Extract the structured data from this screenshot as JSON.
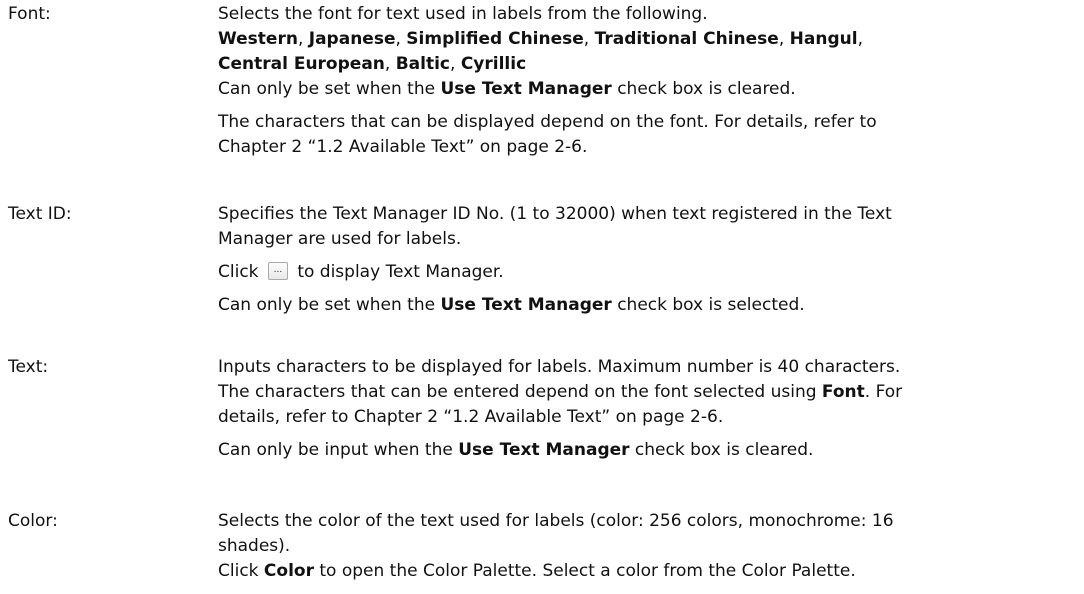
{
  "font": {
    "term": "Font:",
    "intro": "Selects the font for text used in labels from the following.",
    "options": [
      "Western",
      "Japanese",
      "Simplified Chinese",
      "Traditional Chinese",
      "Hangul",
      "Central European",
      "Baltic",
      "Cyrillic"
    ],
    "sep": ", ",
    "note_pre": "Can only be set when the ",
    "note_bold": "Use Text Manager",
    "note_post": " check box is cleared.",
    "chars_line1": "The characters that can be displayed depend on the font. For details, refer to",
    "chars_line2": "Chapter 2 “1.2 Available Text” on page 2-6."
  },
  "text_id": {
    "term": "Text ID:",
    "desc_line1": "Specifies the Text Manager ID No. (1 to 32000) when text registered in the Text",
    "desc_line2": "Manager are used for labels.",
    "click_pre": "Click ",
    "button_glyph": "...",
    "click_post": " to display Text Manager.",
    "note_pre": "Can only be set when the ",
    "note_bold": "Use Text Manager",
    "note_post": " check box is selected."
  },
  "text": {
    "term": "Text:",
    "desc_line1": "Inputs characters to be displayed for labels. Maximum number is 40 characters.",
    "desc_line2_pre": "The characters that can be entered depend on the font selected using ",
    "desc_line2_bold": "Font",
    "desc_line2_post": ". For",
    "desc_line3": "details, refer to Chapter 2 “1.2 Available Text” on page 2-6.",
    "note_pre": "Can only be input when the ",
    "note_bold": "Use Text Manager",
    "note_post": " check box is cleared."
  },
  "color": {
    "term": "Color:",
    "desc_line1": "Selects the color of the text used for labels (color: 256 colors, monochrome: 16",
    "desc_line2": "shades).",
    "click_pre": "Click ",
    "click_bold": "Color",
    "click_post": " to open the Color Palette. Select a color from the Color Palette."
  }
}
